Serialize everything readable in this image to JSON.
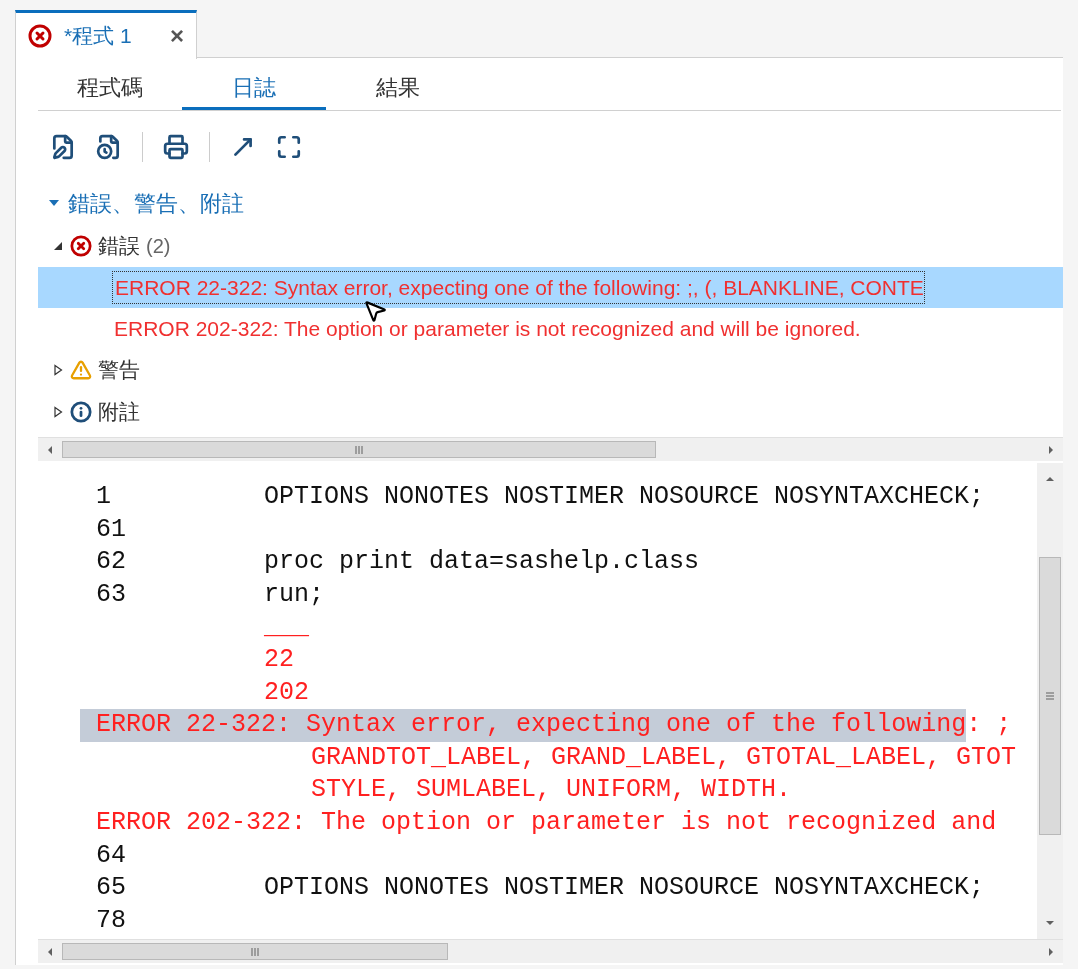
{
  "editor_tab": {
    "title": "*程式 1",
    "has_errors": true,
    "close": "×"
  },
  "view_tabs": [
    {
      "label": "程式碼",
      "selected": false
    },
    {
      "label": "日誌",
      "selected": true
    },
    {
      "label": "結果",
      "selected": false
    }
  ],
  "tree": {
    "label": "錯誤、警告、附註",
    "expanded": true,
    "children": [
      {
        "kind": "error",
        "label": "錯誤",
        "count": "(2)",
        "expanded": true,
        "children": [
          {
            "text": "ERROR 22-322: Syntax error, expecting one of the following: ;, (, BLANKLINE, CONTE",
            "selected": true
          },
          {
            "text": "ERROR 202-322: The option or parameter is not recognized and will be ignored.",
            "selected": false
          }
        ]
      },
      {
        "kind": "warning",
        "label": "警告",
        "expanded": false
      },
      {
        "kind": "note",
        "label": "附註",
        "expanded": false
      }
    ]
  },
  "log_lines": [
    {
      "kind": "code",
      "number": "1",
      "segments": [
        {
          "text": "OPTIONS NONOTES NOSTIMER NOSOURCE NOSYNTAXCHECK;",
          "selected": false
        }
      ],
      "error": false
    },
    {
      "kind": "code",
      "number": "61",
      "error": false
    },
    {
      "kind": "code",
      "number": "62",
      "segments": [
        {
          "text": "proc print data=sashelp.class",
          "selected": false
        }
      ],
      "error": false
    },
    {
      "kind": "code",
      "number": "63",
      "segments": [
        {
          "text": "run;",
          "selected": false
        }
      ],
      "error": false
    },
    {
      "kind": "code",
      "segments": [
        {
          "text": "___",
          "selected": false
        }
      ],
      "error": true
    },
    {
      "kind": "code",
      "segments": [
        {
          "text": "22",
          "selected": false
        }
      ],
      "error": true
    },
    {
      "kind": "code",
      "segments": [
        {
          "text": "202",
          "selected": false
        }
      ],
      "error": true
    },
    {
      "kind": "message",
      "segments": [
        {
          "text": "ERROR 22-322: Syntax error, expecting one of the following",
          "selected": true
        },
        {
          "text": ": ;",
          "selected": false
        }
      ],
      "error": true
    },
    {
      "kind": "continuation",
      "segments": [
        {
          "text": "GRANDTOT_LABEL, GRAND_LABEL, GTOTAL_LABEL, GTOT",
          "selected": false
        }
      ],
      "error": true
    },
    {
      "kind": "continuation",
      "segments": [
        {
          "text": "STYLE, SUMLABEL, UNIFORM, WIDTH.",
          "selected": false
        }
      ],
      "error": true
    },
    {
      "kind": "message",
      "segments": [
        {
          "text": "ERROR 202-322: The option or parameter is not recognized and",
          "selected": false
        }
      ],
      "error": true
    },
    {
      "kind": "code",
      "number": "64",
      "error": false
    },
    {
      "kind": "code",
      "number": "65",
      "segments": [
        {
          "text": "OPTIONS NONOTES NOSTIMER NOSOURCE NOSYNTAXCHECK;",
          "selected": false
        }
      ],
      "error": false
    },
    {
      "kind": "code",
      "number": "78",
      "error": false
    }
  ]
}
